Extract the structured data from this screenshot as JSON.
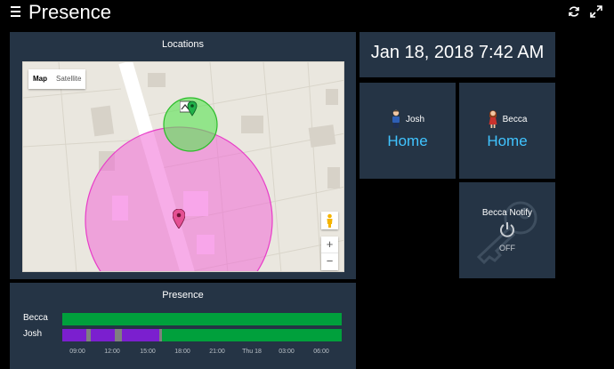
{
  "header": {
    "title": "Presence",
    "icons": [
      "menu-icon",
      "refresh-icon",
      "fullscreen-icon"
    ]
  },
  "locations": {
    "title": "Locations",
    "map_type": {
      "options": [
        "Map",
        "Satellite"
      ],
      "selected": "Map"
    },
    "zoom": {
      "in": "+",
      "out": "−"
    }
  },
  "datetime": "Jan 18, 2018 7:42 AM",
  "people": [
    {
      "name": "Josh",
      "state": "Home"
    },
    {
      "name": "Becca",
      "state": "Home"
    }
  ],
  "notify": {
    "label": "Becca Notify",
    "state": "OFF"
  },
  "presence": {
    "title": "Presence",
    "rows": [
      "Becca",
      "Josh"
    ],
    "ticks": [
      "09:00",
      "12:00",
      "15:00",
      "18:00",
      "21:00",
      "Thu 18",
      "03:00",
      "06:00"
    ]
  },
  "colors": {
    "home": "#00a03c",
    "away": "#7b1fcf",
    "unknown": "#7f7f7f",
    "state_text": "#40c4ff"
  }
}
